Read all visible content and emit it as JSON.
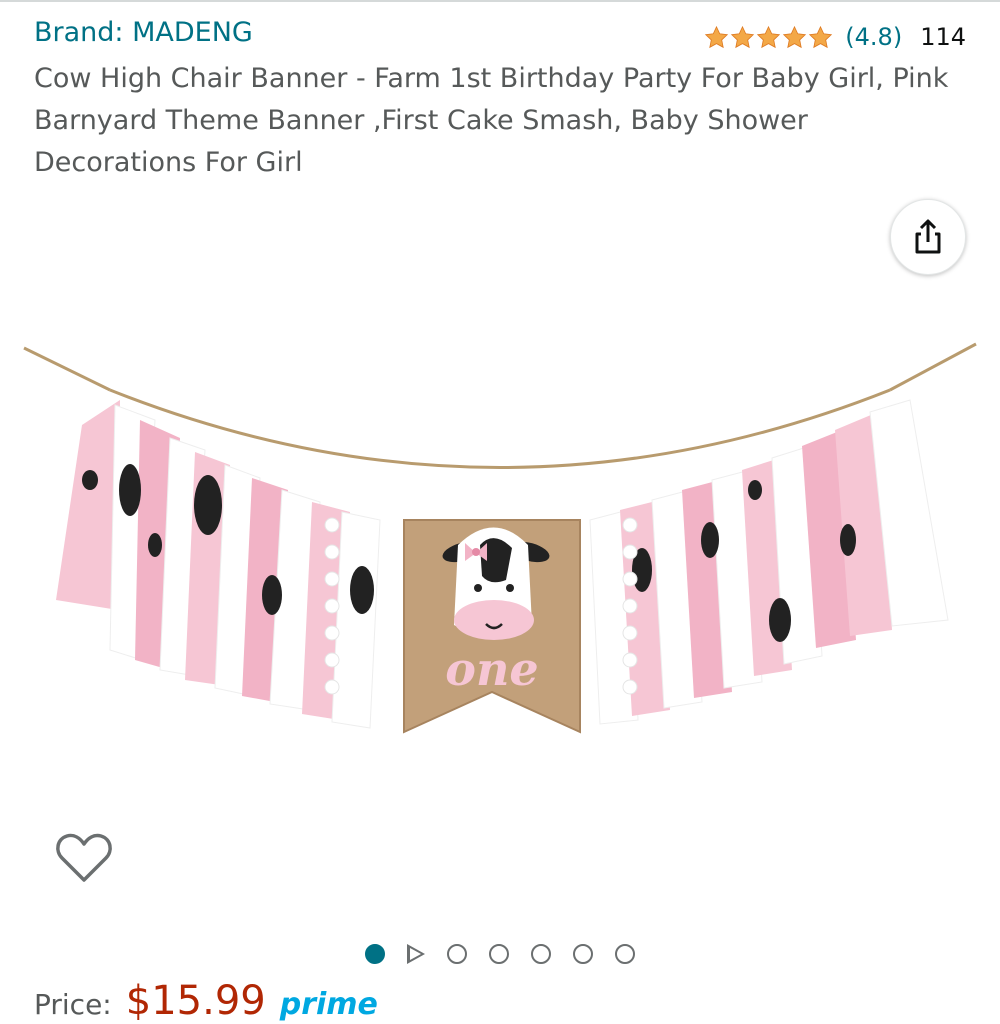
{
  "product": {
    "brand": "Brand: MADENG",
    "rating_value": "(4.8)",
    "rating_stars": 4.8,
    "rating_count": "114",
    "title": "Cow High Chair Banner - Farm 1st Birthday Party For Baby Girl, Pink Barnyard Theme Banner ,First Cake Smash, Baby Shower Decorations For Girl",
    "image_text": "one"
  },
  "gallery": {
    "total_items": 7,
    "active_index": 0,
    "video_index": 1
  },
  "price": {
    "label": "Price:",
    "amount": "$15.99",
    "badge": "prime"
  },
  "colors": {
    "link": "#007185",
    "star": "#f3a847",
    "price": "#b12704",
    "text_secondary": "#565959"
  },
  "icons": {
    "share": "share-icon",
    "wishlist": "heart-icon",
    "star": "star-icon"
  }
}
